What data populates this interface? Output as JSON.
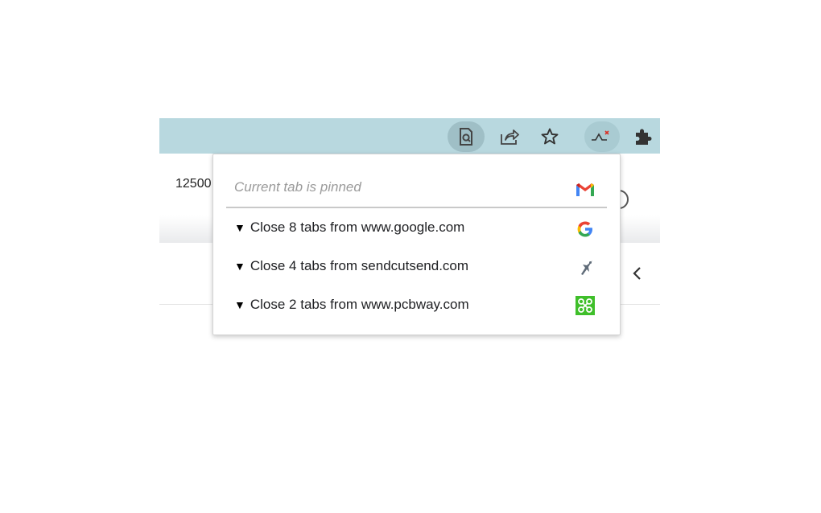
{
  "page": {
    "partial_text": "12500"
  },
  "toolbar": {
    "icons": [
      "zoom-page-icon",
      "share-icon",
      "bookmark-star-icon",
      "tab-extension-icon",
      "puzzle-extensions-icon"
    ],
    "background_color": "#b8d8df"
  },
  "popup": {
    "header_text": "Current tab is pinned",
    "header_icon": "gmail-icon",
    "items": [
      {
        "label": "Close 8 tabs from www.google.com",
        "favicon": "google-icon"
      },
      {
        "label": "Close 4 tabs from sendcutsend.com",
        "favicon": "sendcutsend-icon"
      },
      {
        "label": "Close 2 tabs from www.pcbway.com",
        "favicon": "pcbway-icon"
      }
    ],
    "expand_marker": "▼"
  }
}
